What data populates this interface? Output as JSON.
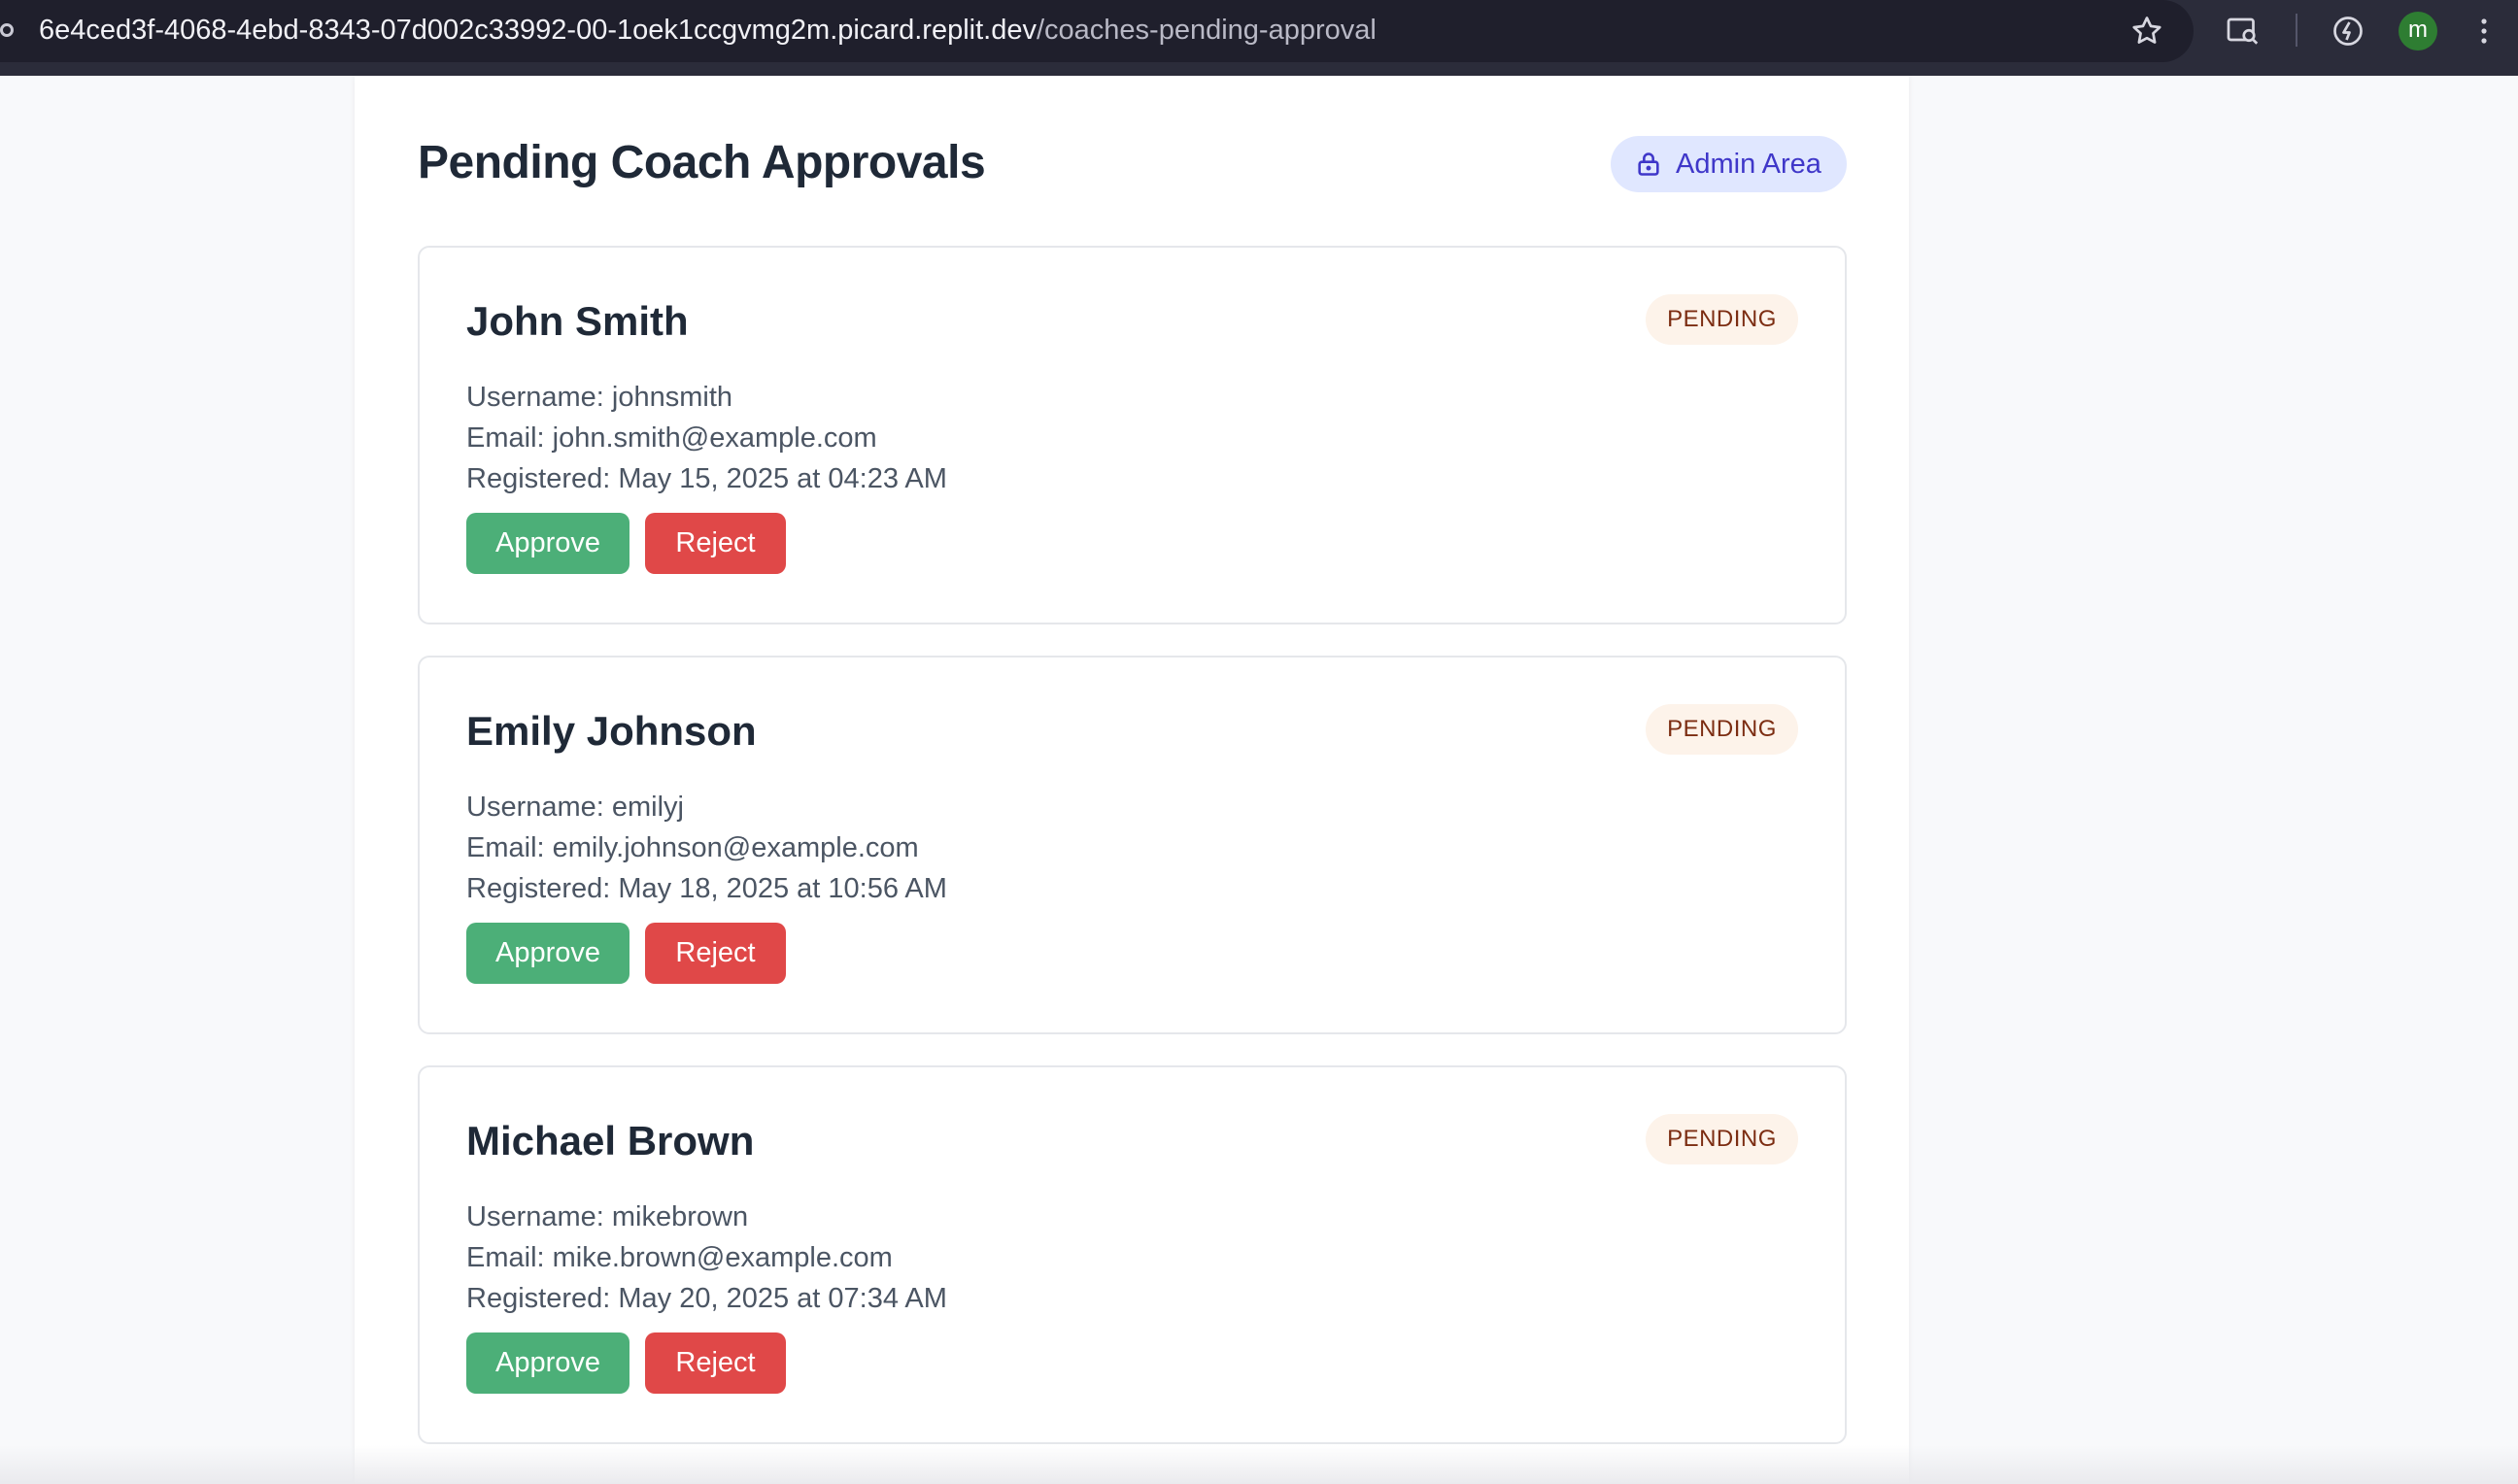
{
  "browser": {
    "url_host": "6e4ced3f-4068-4ebd-8343-07d002c33992-00-1oek1ccgvmg2m.picard.replit.dev",
    "url_path": "/coaches-pending-approval",
    "profile_initial": "m",
    "icons": [
      "site-info-icon",
      "star-icon",
      "tab-search-icon",
      "performance-icon",
      "menu-icon"
    ]
  },
  "page": {
    "title": "Pending Coach Approvals",
    "admin_badge": "Admin Area"
  },
  "coaches": [
    {
      "name": "John Smith",
      "username": "Username: johnsmith",
      "email": "Email: john.smith@example.com",
      "registered": "Registered: May 15, 2025 at 04:23 AM",
      "status": "PENDING",
      "approve_label": "Approve",
      "reject_label": "Reject"
    },
    {
      "name": "Emily Johnson",
      "username": "Username: emilyj",
      "email": "Email: emily.johnson@example.com",
      "registered": "Registered: May 18, 2025 at 10:56 AM",
      "status": "PENDING",
      "approve_label": "Approve",
      "reject_label": "Reject"
    },
    {
      "name": "Michael Brown",
      "username": "Username: mikebrown",
      "email": "Email: mike.brown@example.com",
      "registered": "Registered: May 20, 2025 at 07:34 AM",
      "status": "PENDING",
      "approve_label": "Approve",
      "reject_label": "Reject"
    }
  ],
  "colors": {
    "approve": "#4caf78",
    "reject": "#e04848",
    "admin_badge_bg": "#e0e7ff",
    "admin_badge_text": "#3f37c9",
    "pending_bg": "#fdf3ea",
    "pending_text": "#7c2d12"
  }
}
